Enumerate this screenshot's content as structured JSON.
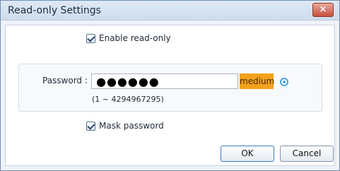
{
  "window": {
    "title": "Read-only Settings",
    "close_symbol": "×"
  },
  "enable_readonly": {
    "label": "Enable read-only",
    "checked": true
  },
  "password": {
    "label": "Password :",
    "value_masked": "●●●●●●",
    "strength": "medium",
    "range_hint": "(1 ~ 4294967295)"
  },
  "mask_password": {
    "label": "Mask password",
    "checked": true
  },
  "buttons": {
    "ok": "OK",
    "cancel": "Cancel"
  },
  "icons": {
    "visibility": "eye-icon"
  },
  "colors": {
    "strength_medium": "#f3a21a",
    "close": "#c9503d",
    "accent": "#4aa1df"
  }
}
